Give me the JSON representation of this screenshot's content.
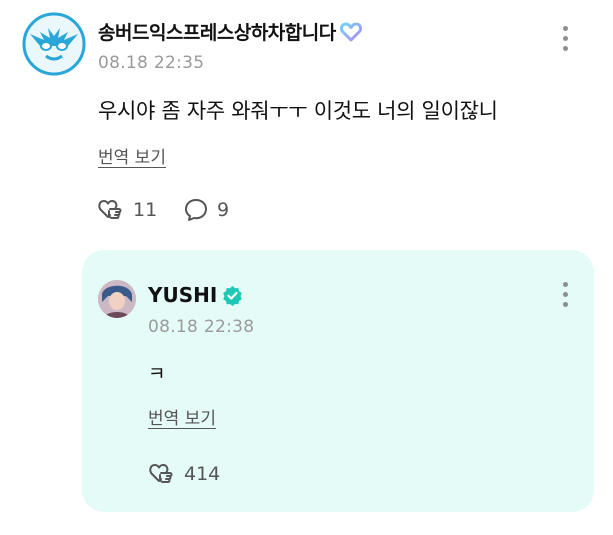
{
  "post": {
    "author": "송버드익스프레스상하차합니다",
    "timestamp": "08.18 22:35",
    "text": "우시야 좀 자주 와줘ㅜㅜ 이것도 너의 일이잖니",
    "translate_label": "번역 보기",
    "like_count": "11",
    "comment_count": "9"
  },
  "reply": {
    "author": "YUSHI",
    "timestamp": "08.18 22:38",
    "text": "ㅋ",
    "translate_label": "번역 보기",
    "like_count": "414"
  },
  "colors": {
    "reply_background": "#e5fbf7",
    "verified": "#1fc8b4",
    "heart_badge_start": "#6fd3f5",
    "heart_badge_end": "#b08cf0",
    "fan_avatar_accent": "#2aa7d8"
  },
  "icons": {
    "heart_badge": "heart-outline-gradient-icon",
    "verified": "verified-badge-icon",
    "more": "more-vertical-icon",
    "like": "heart-hand-icon",
    "comment": "speech-bubble-icon"
  }
}
